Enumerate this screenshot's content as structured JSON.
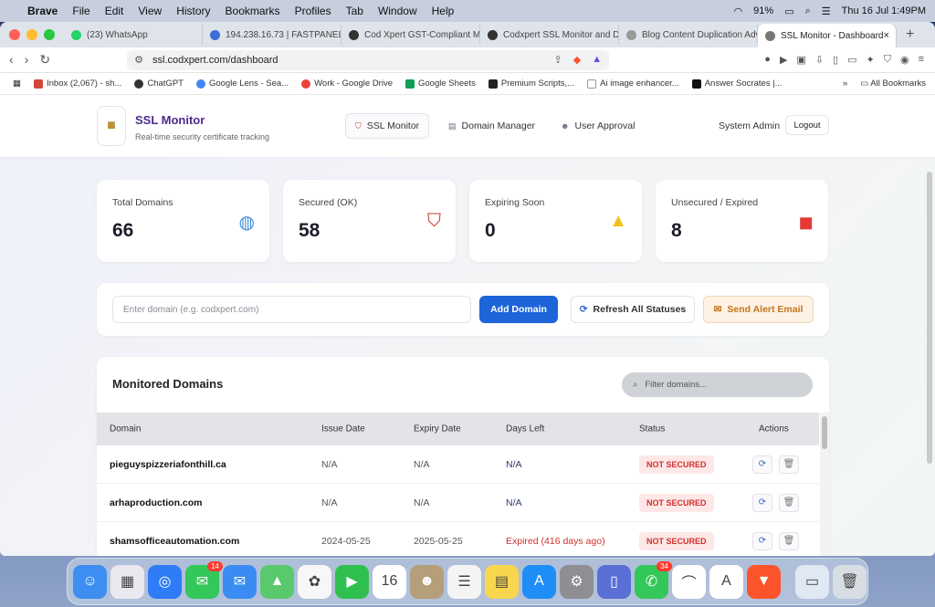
{
  "menubar": {
    "app": "Brave",
    "items": [
      "File",
      "Edit",
      "View",
      "History",
      "Bookmarks",
      "Profiles",
      "Tab",
      "Window",
      "Help"
    ],
    "battery": "91%",
    "datetime": "Thu 16 Jul  1:49PM"
  },
  "tabs": [
    {
      "label": "(23) WhatsApp",
      "icon": "whatsapp-icon",
      "badge": "23"
    },
    {
      "label": "194.238.16.73 | FASTPANEL H",
      "icon": "fastpanel-icon"
    },
    {
      "label": "Cod Xpert GST-Compliant M",
      "icon": "codxpert-icon"
    },
    {
      "label": "Codxpert SSL Monitor and De",
      "icon": "codxpert-icon"
    },
    {
      "label": "Blog Content Duplication Adv",
      "icon": "globe-icon"
    },
    {
      "label": "SSL Monitor - Dashboard",
      "icon": "globe-icon",
      "active": true
    }
  ],
  "address": {
    "url": "ssl.codxpert.com/dashboard"
  },
  "bookmarks": [
    {
      "label": "Inbox (2,067) - sh...",
      "icon": "gmail-icon"
    },
    {
      "label": "ChatGPT",
      "icon": "chatgpt-icon"
    },
    {
      "label": "Google Lens - Sea...",
      "icon": "google-lens-icon"
    },
    {
      "label": "Work - Google Drive",
      "icon": "google-icon"
    },
    {
      "label": "Google Sheets",
      "icon": "sheets-icon"
    },
    {
      "label": "Premium Scripts,...",
      "icon": "scripts-icon"
    },
    {
      "label": "Ai image enhancer...",
      "icon": "ai-icon"
    },
    {
      "label": "Answer Socrates |...",
      "icon": "socrates-icon"
    }
  ],
  "all_bookmarks": "All Bookmarks",
  "header": {
    "brand": "SSL Monitor",
    "tagline": "Real-time security certificate tracking",
    "nav": [
      "SSL Monitor",
      "Domain Manager",
      "User Approval"
    ],
    "user": "System Admin",
    "logout": "Logout"
  },
  "stats": [
    {
      "label": "Total Domains",
      "value": "66",
      "icon": "globe-icon"
    },
    {
      "label": "Secured (OK)",
      "value": "58",
      "icon": "shield-icon"
    },
    {
      "label": "Expiring Soon",
      "value": "0",
      "icon": "warning-icon"
    },
    {
      "label": "Unsecured / Expired",
      "value": "8",
      "icon": "alarm-icon"
    }
  ],
  "actions": {
    "input_placeholder": "Enter domain (e.g. codxpert.com)",
    "add": "Add Domain",
    "refresh": "Refresh All Statuses",
    "alert": "Send Alert Email"
  },
  "table": {
    "title": "Monitored Domains",
    "filter_placeholder": "Filter domains...",
    "columns": [
      "Domain",
      "Issue Date",
      "Expiry Date",
      "Days Left",
      "Status",
      "Actions"
    ],
    "rows": [
      {
        "domain": "pieguyspizzeriafonthill.ca",
        "issue": "N/A",
        "expiry": "N/A",
        "days": "N/A",
        "status": "NOT SECURED"
      },
      {
        "domain": "arhaproduction.com",
        "issue": "N/A",
        "expiry": "N/A",
        "days": "N/A",
        "status": "NOT SECURED"
      },
      {
        "domain": "shamsofficeautomation.com",
        "issue": "2024-05-25",
        "expiry": "2025-05-25",
        "days": "Expired (416 days ago)",
        "status": "NOT SECURED"
      }
    ]
  },
  "dock": [
    {
      "name": "finder",
      "color": "#3d8ef0",
      "glyph": "☺"
    },
    {
      "name": "launchpad",
      "color": "#e9e9ef",
      "glyph": "▦"
    },
    {
      "name": "safari",
      "color": "#2f7cf6",
      "glyph": "◎"
    },
    {
      "name": "messages",
      "color": "#34c759",
      "glyph": "✉",
      "badge": "14"
    },
    {
      "name": "mail",
      "color": "#3a8cf3",
      "glyph": "✉"
    },
    {
      "name": "maps",
      "color": "#5ac86c",
      "glyph": "▲"
    },
    {
      "name": "photos",
      "color": "#f7f7f7",
      "glyph": "✿"
    },
    {
      "name": "facetime",
      "color": "#2fc04f",
      "glyph": "▶"
    },
    {
      "name": "calendar",
      "color": "#ffffff",
      "glyph": "16"
    },
    {
      "name": "contacts",
      "color": "#b59e7a",
      "glyph": "☻"
    },
    {
      "name": "reminders",
      "color": "#f4f4f4",
      "glyph": "☰"
    },
    {
      "name": "notes",
      "color": "#f8d64e",
      "glyph": "▤"
    },
    {
      "name": "app-store",
      "color": "#1f8df6",
      "glyph": "A"
    },
    {
      "name": "settings",
      "color": "#8e8e93",
      "glyph": "⚙"
    },
    {
      "name": "iphone-mirroring",
      "color": "#5a6fd6",
      "glyph": "▯"
    },
    {
      "name": "phone",
      "color": "#34c759",
      "glyph": "✆",
      "badge": "34"
    },
    {
      "name": "nordvpn",
      "color": "#ffffff",
      "glyph": "⌒"
    },
    {
      "name": "arc",
      "color": "#ffffff",
      "glyph": "A"
    },
    {
      "name": "brave",
      "color": "#fb542b",
      "glyph": "▼"
    },
    {
      "name": "downloads",
      "color": "#dfe8f3",
      "glyph": "▭"
    },
    {
      "name": "trash",
      "color": "#d8dde4",
      "glyph": "🗑"
    }
  ]
}
